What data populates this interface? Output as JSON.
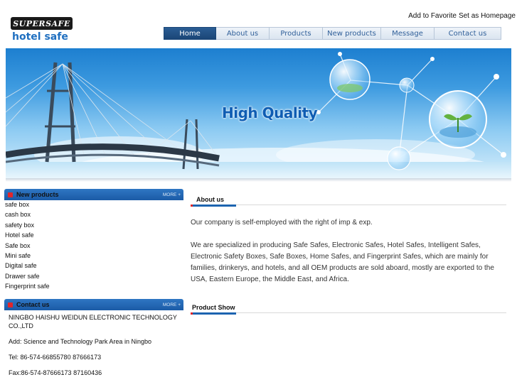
{
  "header": {
    "logo_text": "SUPERSAFE",
    "logo_sub": "hotel safe",
    "links": [
      "Add to Favorite",
      "Set as Homepage"
    ]
  },
  "nav": {
    "items": [
      {
        "label": "Home",
        "active": true
      },
      {
        "label": "About us",
        "active": false
      },
      {
        "label": "Products",
        "active": false
      },
      {
        "label": "New products",
        "active": false
      },
      {
        "label": "Message",
        "active": false
      },
      {
        "label": "Contact us",
        "active": false
      }
    ]
  },
  "banner": {
    "title": "High Quality"
  },
  "new_products": {
    "title": "New products",
    "more": "MORE +",
    "items": [
      "safe box",
      "cash box",
      "safety box",
      "Hotel safe",
      "Safe box",
      "Mini safe",
      "Digital safe",
      "Drawer safe",
      "Fingerprint safe"
    ]
  },
  "contact": {
    "title": "Contact us",
    "more": "MORE +",
    "company": "NINGBO HAISHU WEIDUN ELECTRONIC TECHNOLOGY CO.,LTD",
    "address": "Add: Science and Technology Park Area in Ningbo",
    "tel": "Tel: 86-574-66855780  87666173",
    "fax": "Fax:86-574-87666173  87160436"
  },
  "about": {
    "title": "About us",
    "paragraph1": "Our company is self-employed with the right of imp & exp.",
    "paragraph2": "We are specialized in producing Safe Safes, Electronic Safes, Hotel Safes, Intelligent Safes, Electronic Safety Boxes, Safe Boxes, Home Safes, and Fingerprint Safes, which are mainly for families, drinkerys, and hotels, and all OEM products are sold aboard, mostly are exported to the USA, Eastern Europe, the Middle East, and Africa."
  },
  "product_show": {
    "title": "Product Show"
  }
}
